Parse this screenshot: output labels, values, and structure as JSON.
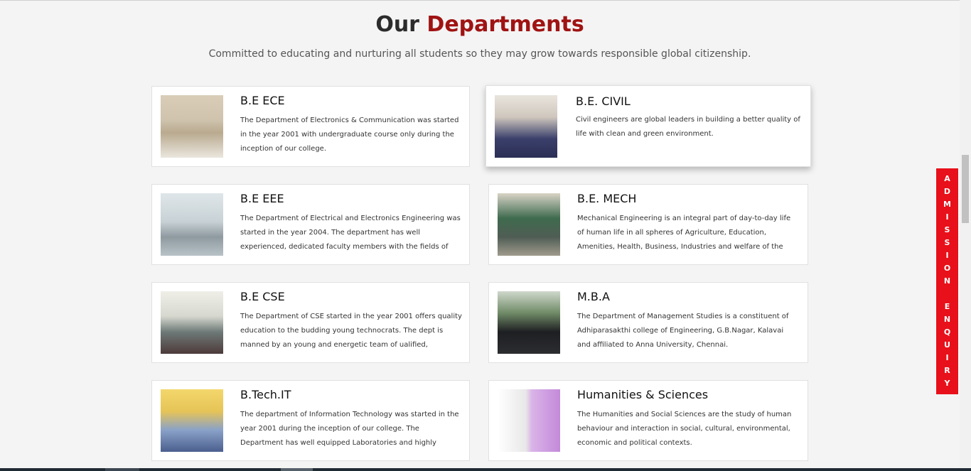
{
  "header": {
    "title_prefix": "Our",
    "title_accent": "Departments",
    "subtitle": "Committed to educating and nurturing all students so they may grow towards responsible global citizenship."
  },
  "departments": [
    {
      "name": "B.E ECE",
      "description": "The Department of Electronics & Communication was started in the year 2001 with undergraduate course only during the inception of our college."
    },
    {
      "name": "B.E. CIVIL",
      "description": "Civil engineers are global leaders in building a better quality of life with clean and green environment."
    },
    {
      "name": "B.E EEE",
      "description": "The Department of Electrical and Electronics Engineering was started in the year 2004. The department has well experienced, dedicated faculty members with the fields of specialization."
    },
    {
      "name": "B.E. MECH",
      "description": "Mechanical Engineering is an integral part of day-to-day life of human life in all spheres of Agriculture, Education, Amenities, Health, Business, Industries and welfare of the nation."
    },
    {
      "name": "B.E CSE",
      "description": "The Department of CSE started in the year 2001 offers quality education to the budding young technocrats. The dept is manned by an young and energetic team of ualified, dedicated.."
    },
    {
      "name": "M.B.A",
      "description": "The Department of Management Studies is a constituent of Adhiparasakthi college of Engineering, G.B.Nagar, Kalavai and affiliated to Anna University, Chennai."
    },
    {
      "name": "B.Tech.IT",
      "description": "The department of Information Technology was started in the year 2001 during the inception of our college. The Department has well equipped Laboratories and highly committed Faculty ...."
    },
    {
      "name": "Humanities & Sciences",
      "description": "The Humanities and Social Sciences are the study of human behaviour and interaction in social, cultural, environmental, economic and political contexts."
    }
  ],
  "enquiry_tab": {
    "letters": [
      "A",
      "D",
      "M",
      "I",
      "S",
      "S",
      "I",
      "O",
      "N",
      " ",
      "E",
      "N",
      "Q",
      "U",
      "I",
      "R",
      "Y"
    ],
    "color": "#e8101a"
  },
  "colors": {
    "accent": "#a01313",
    "background": "#f4f4f4"
  }
}
